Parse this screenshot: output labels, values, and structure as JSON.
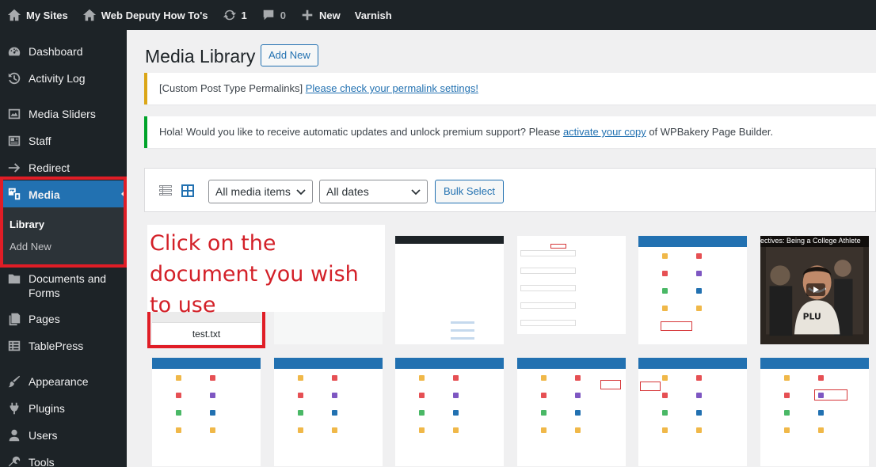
{
  "adminbar": {
    "my_sites": "My Sites",
    "site_name": "Web Deputy How To's",
    "updates_count": "1",
    "comments_count": "0",
    "new_label": "New",
    "varnish": "Varnish"
  },
  "sidebar": {
    "items": [
      {
        "label": "Dashboard",
        "icon": "dashboard-icon"
      },
      {
        "label": "Activity Log",
        "icon": "history-icon"
      },
      {
        "label": "Media Sliders",
        "icon": "slides-icon"
      },
      {
        "label": "Staff",
        "icon": "id-card-icon"
      },
      {
        "label": "Redirect",
        "icon": "arrow-right-icon"
      },
      {
        "label": "Media",
        "icon": "media-icon"
      },
      {
        "label": "Documents and Forms",
        "icon": "folder-icon"
      },
      {
        "label": "Pages",
        "icon": "pages-icon"
      },
      {
        "label": "TablePress",
        "icon": "table-icon"
      },
      {
        "label": "Appearance",
        "icon": "brush-icon"
      },
      {
        "label": "Plugins",
        "icon": "plugin-icon"
      },
      {
        "label": "Users",
        "icon": "users-icon"
      },
      {
        "label": "Tools",
        "icon": "wrench-icon"
      }
    ],
    "submenu": {
      "library": "Library",
      "add_new": "Add New"
    }
  },
  "main": {
    "title": "Media Library",
    "add_new": "Add New",
    "notice1": {
      "text": "[Custom Post Type Permalinks] ",
      "link": "Please check your permalink settings!"
    },
    "notice2": {
      "prefix": "Hola! Would you like to receive automatic updates and unlock premium support? Please ",
      "link1": "activate your copy",
      "suffix": " of WPBakery Page Builder."
    },
    "filters": {
      "media_type": "All media items",
      "dates": "All dates",
      "bulk_select": "Bulk Select"
    },
    "document_name": "test.txt",
    "annotation": "Click on the document you wish to use",
    "video_caption": "ectives: Being a College Athlete"
  },
  "colors": {
    "accent": "#2271b1",
    "sidebar_bg": "#1d2327",
    "highlight_red": "#e01d26",
    "notice_yellow": "#dba617",
    "notice_green": "#00a32a"
  }
}
